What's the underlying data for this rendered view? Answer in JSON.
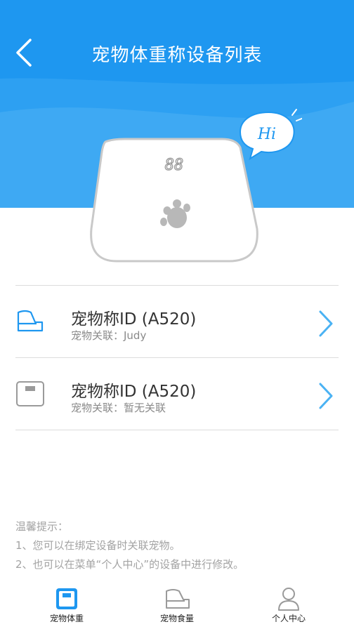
{
  "header": {
    "title": "宠物体重称设备列表"
  },
  "illustration": {
    "display_digits": "88",
    "bubble_text": "Hi"
  },
  "devices": [
    {
      "name": "宠物称ID (A520)",
      "subtitle": "宠物关联：Judy",
      "icon": "scale-tray-icon"
    },
    {
      "name": "宠物称ID (A520)",
      "subtitle": "宠物关联：暂无关联",
      "icon": "scale-box-icon"
    }
  ],
  "tips": {
    "heading": "温馨提示：",
    "lines": [
      "1、您可以在绑定设备时关联宠物。",
      "2、也可以在菜单“个人中心”的设备中进行修改。"
    ]
  },
  "tabbar": {
    "items": [
      {
        "label": "宠物体重",
        "icon": "scale-icon",
        "active": true
      },
      {
        "label": "宠物食量",
        "icon": "food-bowl-icon",
        "active": false
      },
      {
        "label": "个人中心",
        "icon": "person-icon",
        "active": false
      }
    ]
  },
  "colors": {
    "brand_blue": "#1e97f0",
    "accent_light_blue": "#4ab2f3"
  }
}
